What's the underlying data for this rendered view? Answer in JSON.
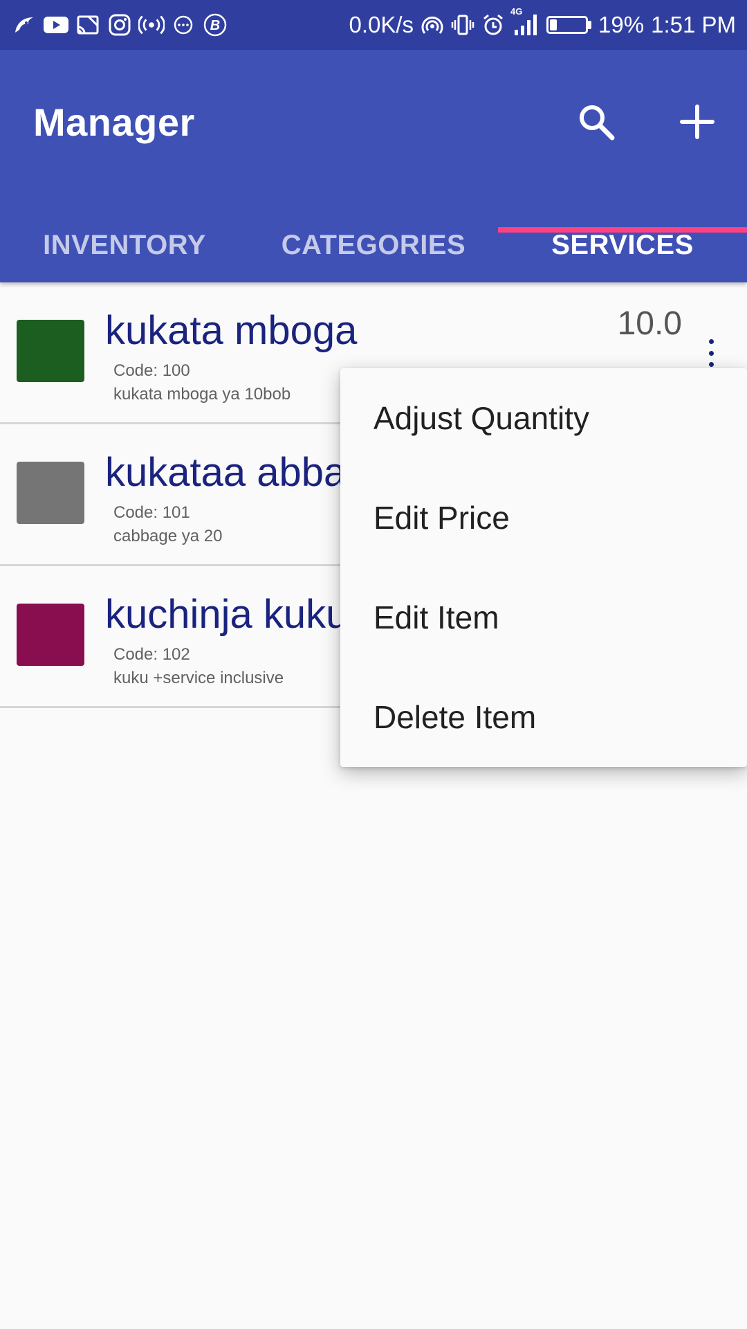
{
  "status_bar": {
    "net_speed": "0.0K/s",
    "network_type": "4G",
    "battery_percent": "19%",
    "battery_level": 0.19,
    "time": "1:51 PM",
    "left_icons": [
      "bird-app-icon",
      "youtube-icon",
      "cast-icon",
      "instagram-icon",
      "broadcast-icon",
      "chat-icon",
      "b-app-icon"
    ],
    "right_icons": [
      "hotspot-icon",
      "vibrate-icon",
      "alarm-icon",
      "signal-icon",
      "battery-icon"
    ]
  },
  "toolbar": {
    "title": "Manager",
    "actions": [
      "search-icon",
      "add-icon"
    ]
  },
  "tabs": [
    {
      "label": "INVENTORY",
      "active": false
    },
    {
      "label": "CATEGORIES",
      "active": false
    },
    {
      "label": "SERVICES",
      "active": true
    }
  ],
  "items": [
    {
      "name": "kukata mboga",
      "code": "Code: 100",
      "description": "kukata mboga ya 10bob",
      "price": "10.0",
      "color": "#1b5e20"
    },
    {
      "name": "kukataa abbage",
      "code": "Code: 101",
      "description": "cabbage ya 20",
      "price": "",
      "color": "#757575"
    },
    {
      "name": "kuchinja kuku",
      "code": "Code: 102",
      "description": "kuku +service inclusive",
      "price": "",
      "color": "#880e4f"
    }
  ],
  "popup_menu": {
    "items": [
      "Adjust Quantity",
      "Edit Price",
      "Edit Item",
      "Delete Item"
    ]
  },
  "colors": {
    "status_bar": "#303f9f",
    "primary": "#3f51b5",
    "accent": "#ff4081",
    "item_title": "#1a237e"
  }
}
